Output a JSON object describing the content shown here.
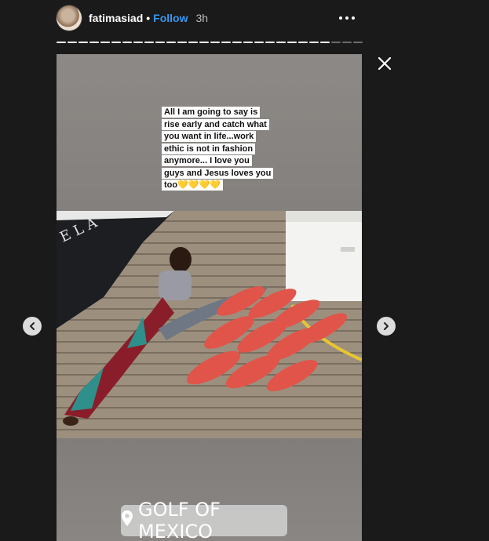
{
  "header": {
    "username": "fatimasiad",
    "separator": "•",
    "follow_label": "Follow",
    "time_ago": "3h"
  },
  "progress": {
    "segments_total": 28,
    "segments_viewed": 25
  },
  "story": {
    "caption": "All I am going to say is rise early and catch what you want in life...work ethic is not in fashion anymore... I love you guys and Jesus loves you too💛💛💛💛",
    "location_sticker": "GOLF OF MEXICO"
  },
  "colors": {
    "background": "#1a1a1a",
    "follow_accent": "#3897f0",
    "progress_viewed": "#ffffff",
    "progress_unviewed": "#6b6b6b",
    "story_backdrop": "#878380"
  },
  "icons": {
    "close": "close-icon",
    "more": "more-options-icon",
    "prev": "chevron-left-icon",
    "next": "chevron-right-icon",
    "location": "location-pin-icon"
  }
}
